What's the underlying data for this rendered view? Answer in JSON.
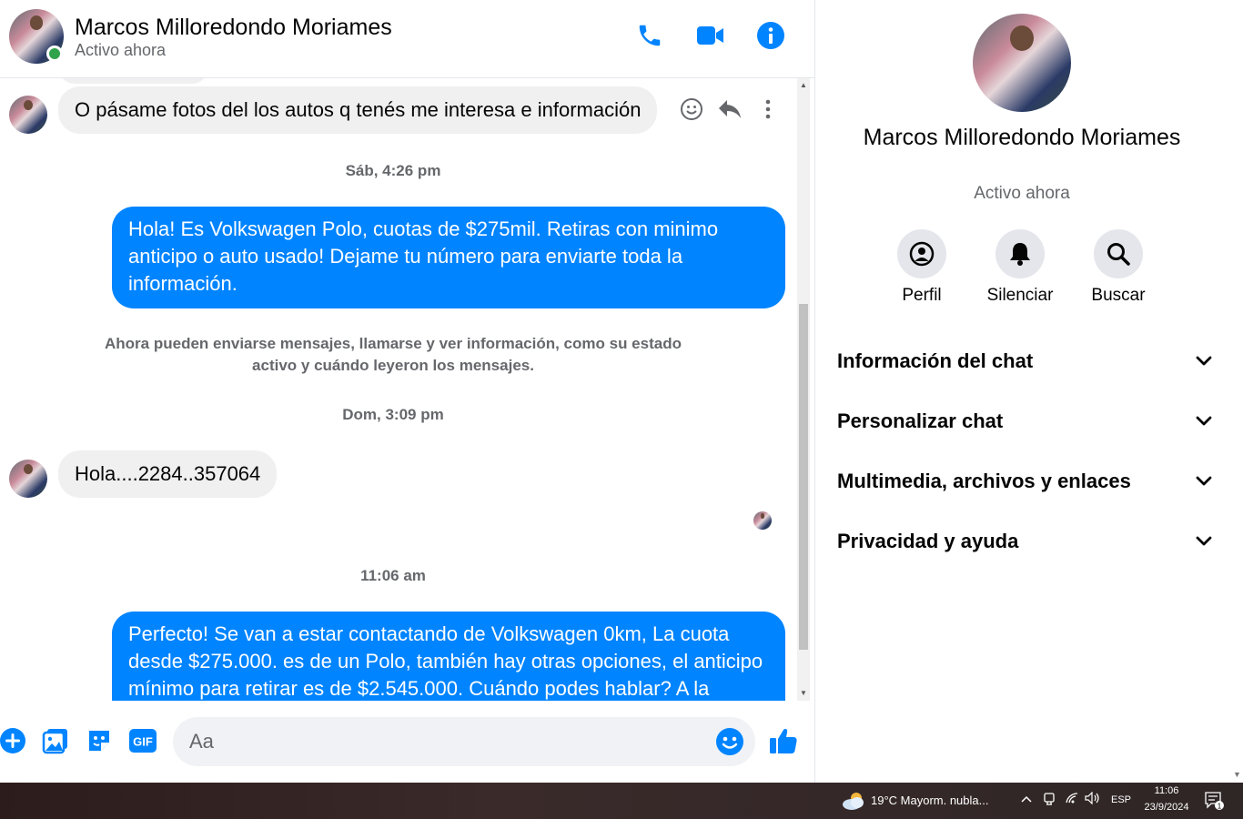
{
  "contact": {
    "name": "Marcos Milloredondo Moriames",
    "status": "Activo ahora"
  },
  "header_actions": [
    "phone-icon",
    "video-icon",
    "info-icon"
  ],
  "messages": [
    {
      "dir": "in",
      "text": "O pásame fotos del los autos q tenés me interesa e información"
    },
    {
      "type": "timestamp",
      "text": "Sáb, 4:26 pm"
    },
    {
      "dir": "out",
      "text": "Hola! Es Volkswagen Polo, cuotas de $275mil. Retiras con minimo anticipo o auto usado! Dejame tu número para enviarte toda la información."
    },
    {
      "type": "system",
      "text": "Ahora pueden enviarse mensajes, llamarse y ver información, como su estado activo y cuándo leyeron los mensajes."
    },
    {
      "type": "timestamp",
      "text": "Dom, 3:09 pm"
    },
    {
      "dir": "in",
      "text": "Hola....2284..357064"
    },
    {
      "type": "timestamp",
      "text": "11:06 am"
    },
    {
      "dir": "out",
      "text": "Perfecto!  Se van a estar contactando de Volkswagen 0km, La cuota desde $275.000. es de un Polo, también hay otras opciones, el anticipo mínimo para retirar es de $2.545.000. Cuándo podes hablar? A la"
    }
  ],
  "composer": {
    "placeholder": "Aa",
    "icons": [
      "plus-icon",
      "image-icon",
      "sticker-icon",
      "gif-icon",
      "emoji-icon",
      "like-icon"
    ],
    "gif_label": "GIF"
  },
  "side_panel": {
    "name": "Marcos Milloredondo Moriames",
    "status": "Activo ahora",
    "actions": [
      {
        "label": "Perfil",
        "icon": "profile-icon"
      },
      {
        "label": "Silenciar",
        "icon": "bell-icon"
      },
      {
        "label": "Buscar",
        "icon": "search-icon"
      }
    ],
    "sections": [
      {
        "label": "Información del chat"
      },
      {
        "label": "Personalizar chat"
      },
      {
        "label": "Multimedia, archivos y enlaces"
      },
      {
        "label": "Privacidad y ayuda"
      }
    ]
  },
  "taskbar": {
    "weather": "19°C  Mayorm. nubla...",
    "language": "ESP",
    "time": "11:06",
    "date": "23/9/2024",
    "notification_count": "1"
  },
  "colors": {
    "accent": "#0084ff",
    "online": "#31a24c",
    "incoming_bubble": "#f0f0f0"
  }
}
